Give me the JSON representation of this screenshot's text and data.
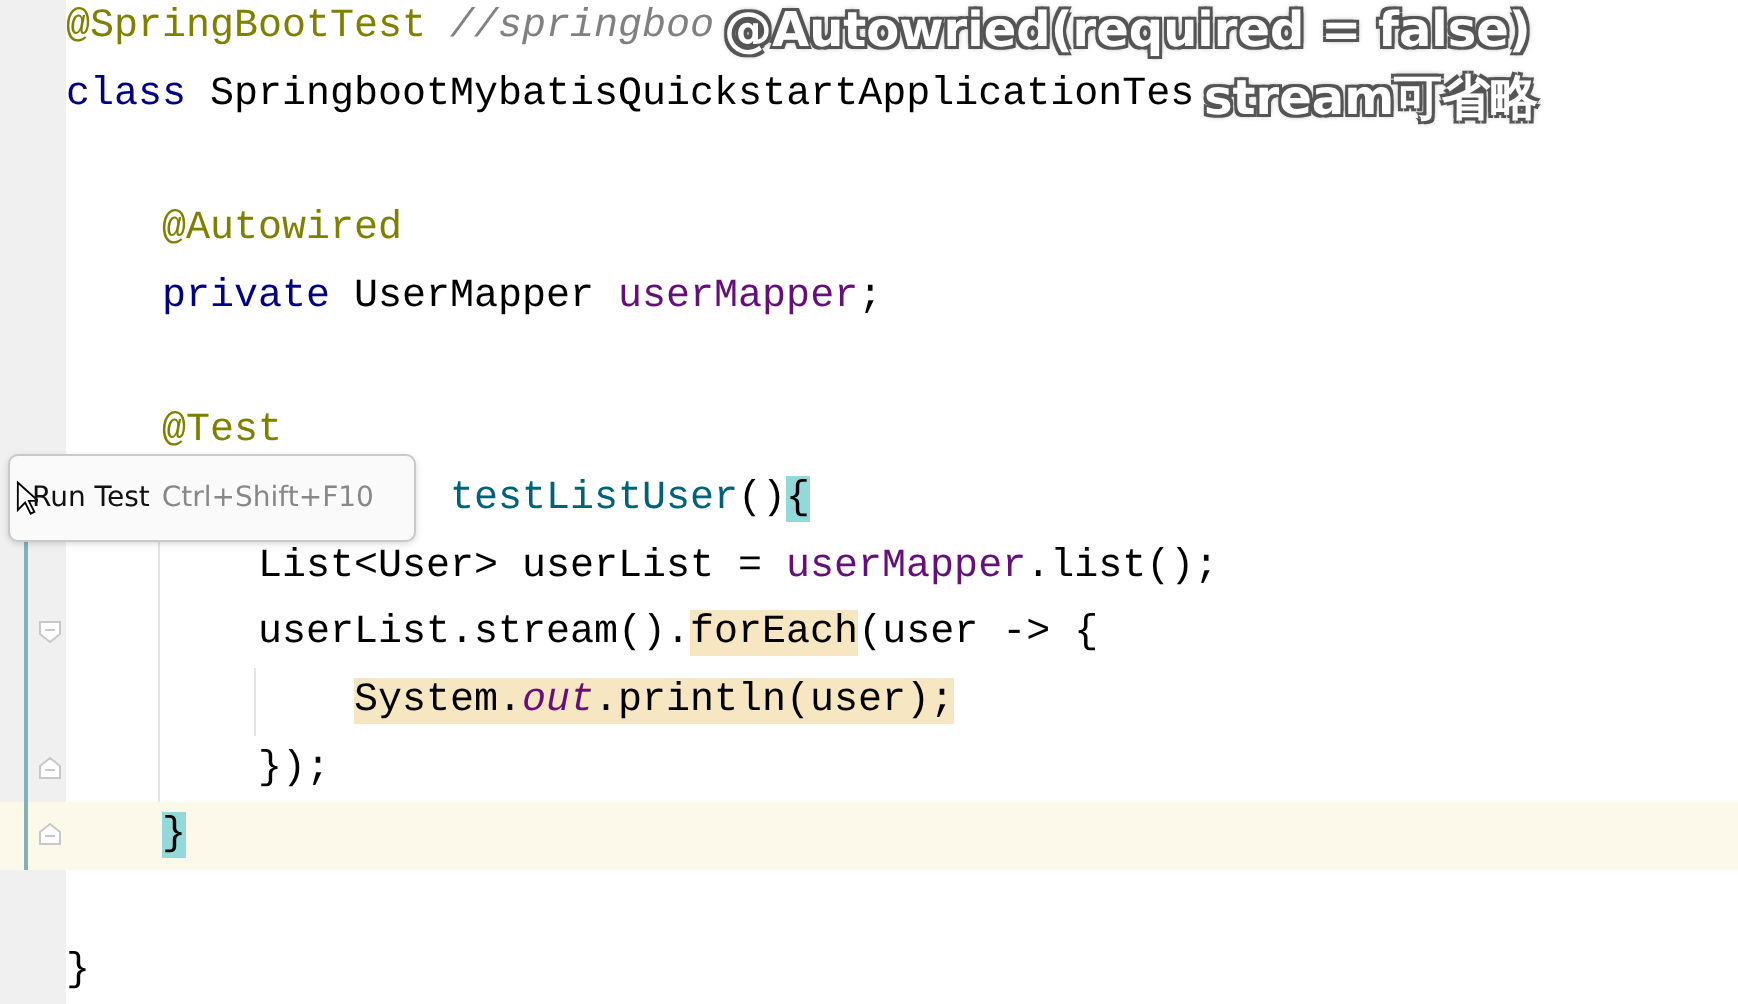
{
  "editor": {
    "lines": [
      {
        "kind": "top",
        "tokens": [
          {
            "text": "@SpringBootTest ",
            "kind": "annotation"
          },
          {
            "text": "//springboo",
            "kind": "comment"
          }
        ]
      },
      {
        "kind": "top",
        "tokens": [
          {
            "text": "class",
            "kind": "keyword"
          },
          {
            "text": " SpringbootMybatisQuickstartApplicationTes",
            "kind": "plain"
          }
        ]
      },
      {
        "kind": "blank"
      },
      {
        "kind": "member",
        "tokens": [
          {
            "text": "@Autowired",
            "kind": "annotation"
          }
        ]
      },
      {
        "kind": "member",
        "tokens": [
          {
            "text": "private",
            "kind": "keyword"
          },
          {
            "text": " UserMapper ",
            "kind": "plain"
          },
          {
            "text": "userMapper",
            "kind": "field"
          },
          {
            "text": ";",
            "kind": "plain"
          }
        ]
      },
      {
        "kind": "blank"
      },
      {
        "kind": "member",
        "tokens": [
          {
            "text": "@Test",
            "kind": "annotation"
          }
        ]
      },
      {
        "kind": "member-tail",
        "changed": true,
        "tokens": [
          {
            "text": "testListUser",
            "kind": "method"
          },
          {
            "text": "()",
            "kind": "plain"
          },
          {
            "text": "{",
            "kind": "plain",
            "match": true
          }
        ]
      },
      {
        "kind": "body",
        "changed": true,
        "tokens": [
          {
            "text": "List<User> userList = ",
            "kind": "plain"
          },
          {
            "text": "userMapper",
            "kind": "field"
          },
          {
            "text": ".list();",
            "kind": "plain"
          }
        ]
      },
      {
        "kind": "body",
        "changed": true,
        "fold_start": true,
        "tokens": [
          {
            "text": "userList.stream().",
            "kind": "plain"
          },
          {
            "text": "forEach",
            "kind": "plain",
            "usage": true
          },
          {
            "text": "(user -> {",
            "kind": "plain"
          }
        ]
      },
      {
        "kind": "inner",
        "changed": true,
        "tokens": [
          {
            "text": "System.",
            "kind": "plain",
            "usage": true
          },
          {
            "text": "out",
            "kind": "static",
            "usage": true
          },
          {
            "text": ".println(user);",
            "kind": "plain",
            "usage": true
          }
        ]
      },
      {
        "kind": "body",
        "changed": true,
        "fold_end": true,
        "tokens": [
          {
            "text": "});",
            "kind": "plain"
          }
        ]
      },
      {
        "kind": "member",
        "changed": true,
        "current": true,
        "fold_end": true,
        "tokens": [
          {
            "text": "}",
            "kind": "plain",
            "match": true
          }
        ]
      },
      {
        "kind": "blank"
      },
      {
        "kind": "top",
        "tokens": [
          {
            "text": "}",
            "kind": "plain"
          }
        ]
      }
    ]
  },
  "tooltip": {
    "label": "Run Test",
    "shortcut": "Ctrl+Shift+F10"
  },
  "caption": [
    "@Autowried(required = false)",
    "stream可省略"
  ]
}
